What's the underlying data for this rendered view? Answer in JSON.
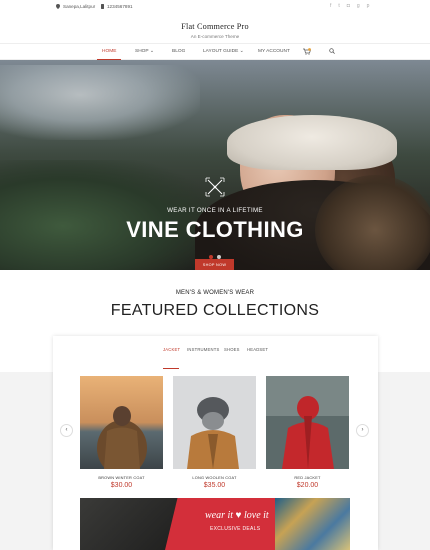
{
  "topbar": {
    "location": "Sanepa,Lalitpur",
    "phone": "1234567891",
    "social": [
      "facebook-icon",
      "twitter-icon",
      "instagram-icon",
      "googleplus-icon",
      "pinterest-icon"
    ]
  },
  "brand": {
    "title": "Flat Commerce Pro",
    "subtitle": "An E-commerce Theme"
  },
  "nav": {
    "items": [
      "HOME",
      "SHOP",
      "BLOG",
      "LAYOUT GUIDE",
      "MY ACCOUNT"
    ],
    "active": "HOME",
    "cart_count": "0"
  },
  "hero": {
    "tagline": "WEAR IT ONCE IN A LIFETIME",
    "heading": "VINE CLOTHING",
    "button": "SHOP NOW",
    "slides": 2,
    "active_slide": 1
  },
  "section": {
    "subtitle": "MEN'S & WOMEN'S WEAR",
    "title": "FEATURED COLLECTIONS"
  },
  "tabs": {
    "items": [
      "JACKET",
      "INSTRUMENTS",
      "SHOES",
      "HEADSET"
    ],
    "active": "JACKET"
  },
  "products": [
    {
      "name": "BROWN WINTER COAT",
      "price": "$30.00"
    },
    {
      "name": "LONG WOOLEN COAT",
      "price": "$35.00"
    },
    {
      "name": "RED JACKET",
      "price": "$20.00"
    }
  ],
  "banner": {
    "script": "wear it ♥ love it",
    "sub": "EXCLUSIVE DEALS"
  },
  "colors": {
    "accent": "#c0392b"
  }
}
